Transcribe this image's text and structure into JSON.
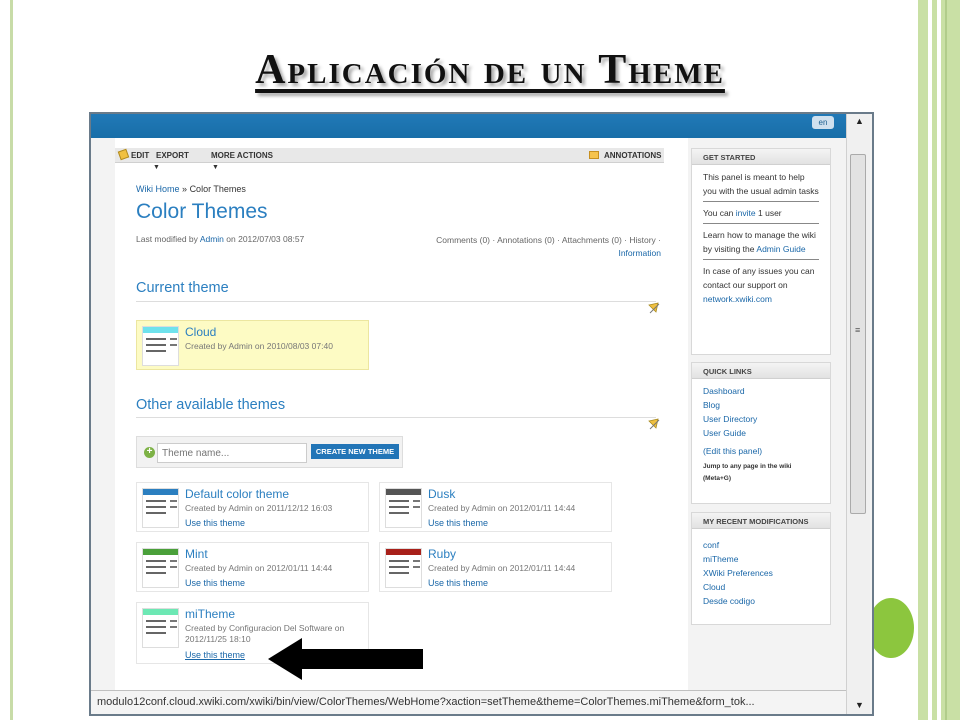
{
  "slide": {
    "title": "Aplicación de un Theme",
    "colors": {
      "accent_green": "#8cc63e",
      "xwiki_blue": "#2179b7"
    }
  },
  "toolbar": {
    "edit": "EDIT",
    "export": "EXPORT",
    "more_actions": "MORE ACTIONS",
    "annotations": "ANNOTATIONS",
    "arrow": "▼"
  },
  "page": {
    "breadcrumb_home": "Wiki Home",
    "breadcrumb_sep": "»",
    "breadcrumb_current": "Color Themes",
    "title": "Color Themes",
    "meta_prefix": "Last modified by",
    "meta_author": "Admin",
    "meta_date": "on 2012/07/03 08:57",
    "doc_links_line1": "Comments (0) · Annotations (0) · Attachments (0) · History ·",
    "doc_links_line2": "Information"
  },
  "current_section": {
    "title": "Current theme"
  },
  "current_theme": {
    "name": "Cloud",
    "meta": "Created by Admin on 2010/08/03 07:40",
    "band_color": "#6fe2ec"
  },
  "other_section": {
    "title": "Other available themes"
  },
  "create": {
    "placeholder": "Theme name...",
    "button": "CREATE NEW THEME"
  },
  "themes": [
    {
      "name": "Default color theme",
      "meta": "Created by Admin on 2011/12/12 16:03",
      "use": "Use this theme",
      "band_color": "#2b7fc0"
    },
    {
      "name": "Dusk",
      "meta": "Created by Admin on 2012/01/11 14:44",
      "use": "Use this theme",
      "band_color": "#555555"
    },
    {
      "name": "Mint",
      "meta": "Created by Admin on 2012/01/11 14:44",
      "use": "Use this theme",
      "band_color": "#4aa03a"
    },
    {
      "name": "Ruby",
      "meta": "Created by Admin on 2012/01/11 14:44",
      "use": "Use this theme",
      "band_color": "#a8201a"
    },
    {
      "name": "miTheme",
      "meta_line1": "Created by Configuracion Del Software on",
      "meta_line2": "2012/11/25 18:10",
      "use": "Use this theme",
      "band_color": "#6de8b4"
    }
  ],
  "panels": {
    "get_started": {
      "title": "GET STARTED",
      "p1": "This panel is meant to help you with the usual admin tasks",
      "p2_prefix": "You can",
      "p2_link": "invite",
      "p2_suffix": "1 user",
      "p3_prefix": "Learn how to manage the wiki by visiting the",
      "p3_link": "Admin Guide",
      "p4_prefix": "In case of any issues you can contact our support on",
      "p4_link": "network.xwiki.com"
    },
    "quick_links": {
      "title": "QUICK LINKS",
      "items": [
        "Dashboard",
        "Blog",
        "User Directory",
        "User Guide"
      ],
      "edit": "(Edit this panel)",
      "jump_line1": "Jump to any page in the wiki",
      "jump_line2": "(Meta+G)"
    },
    "recent": {
      "title": "MY RECENT MODIFICATIONS",
      "items": [
        "conf",
        "miTheme",
        "XWiki Preferences",
        "Cloud",
        "Desde codigo"
      ]
    }
  },
  "statusbar": {
    "url": "modulo12conf.cloud.xwiki.com/xwiki/bin/view/ColorThemes/WebHome?xaction=setTheme&theme=ColorThemes.miTheme&form_tok..."
  }
}
